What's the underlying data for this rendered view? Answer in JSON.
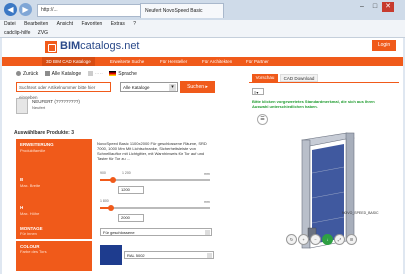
{
  "browser": {
    "url": "http://...",
    "tab_title": "Neufert NovoSpeed Basic",
    "menu": [
      "Datei",
      "Bearbeiten",
      "Ansicht",
      "Favoriten",
      "Extras",
      "?"
    ],
    "favorites": [
      "cadclip-hilfe",
      "ZVG"
    ]
  },
  "header": {
    "logo_text": "BIM",
    "logo_sub": "catalogs.net",
    "login_label": "Login"
  },
  "nav": {
    "items": [
      "3D BIM CAD Kataloge",
      "Erweiterte Suche",
      "Für Hersteller",
      "Für Architekten",
      "Für Partner"
    ]
  },
  "toolbar": {
    "back": "Zurück",
    "all_catalogs": "Alle Kataloge",
    "search_label": "Sprache"
  },
  "search": {
    "placeholder": "Suchtext oder Artikelnummer bitte hier eingeben",
    "select_value": "Alle Kataloge",
    "button": "Suchen"
  },
  "product": {
    "name": "NEUFERT (?????????)",
    "company": "Neufert"
  },
  "section_title": "Auswählbare Produkte: 3",
  "rows": {
    "desc": {
      "label": "ERWEITERUNG",
      "sub": "Produktfamilie",
      "text": "NovoSpeed Basic 1100x2000 Für geschlossene Räume, SRD 7000, 1000 Mm Mit Lichtschranke, Sicherheitsleiste von Schnelllauftor mit Lichtgitter, mit Warnhinweis für Tor auf und Taster für Tor zu ..."
    },
    "width": {
      "label": "B",
      "sub": "Max. Breite",
      "min": "900",
      "mid": "1 200",
      "max": "3000",
      "value": "1200",
      "unit": "mm",
      "fraction": 0.12
    },
    "height": {
      "label": "H",
      "sub": "Max. Höhe",
      "min": "1 800",
      "max": "4000",
      "value": "2000",
      "unit": "mm",
      "fraction": 0.1
    },
    "mount": {
      "label": "MONTAGE",
      "sub": "Für innen",
      "value": "Für geschlossene"
    },
    "color": {
      "label": "COLOUR",
      "sub": "Farbe des Tors",
      "value": "RAL 5002"
    }
  },
  "right_panel": {
    "tab_preview": "Vorschau",
    "tab_download": "CAD Download",
    "info": "Bitte klicken vorgewertetes Standardmerkmal, die sich aus Ihren Auswahl unterschiedlichen haben.",
    "model_label": "NOVO_SPEED_BASIC",
    "accent": "#f05a1a",
    "door_color": "#1e3c8e"
  }
}
